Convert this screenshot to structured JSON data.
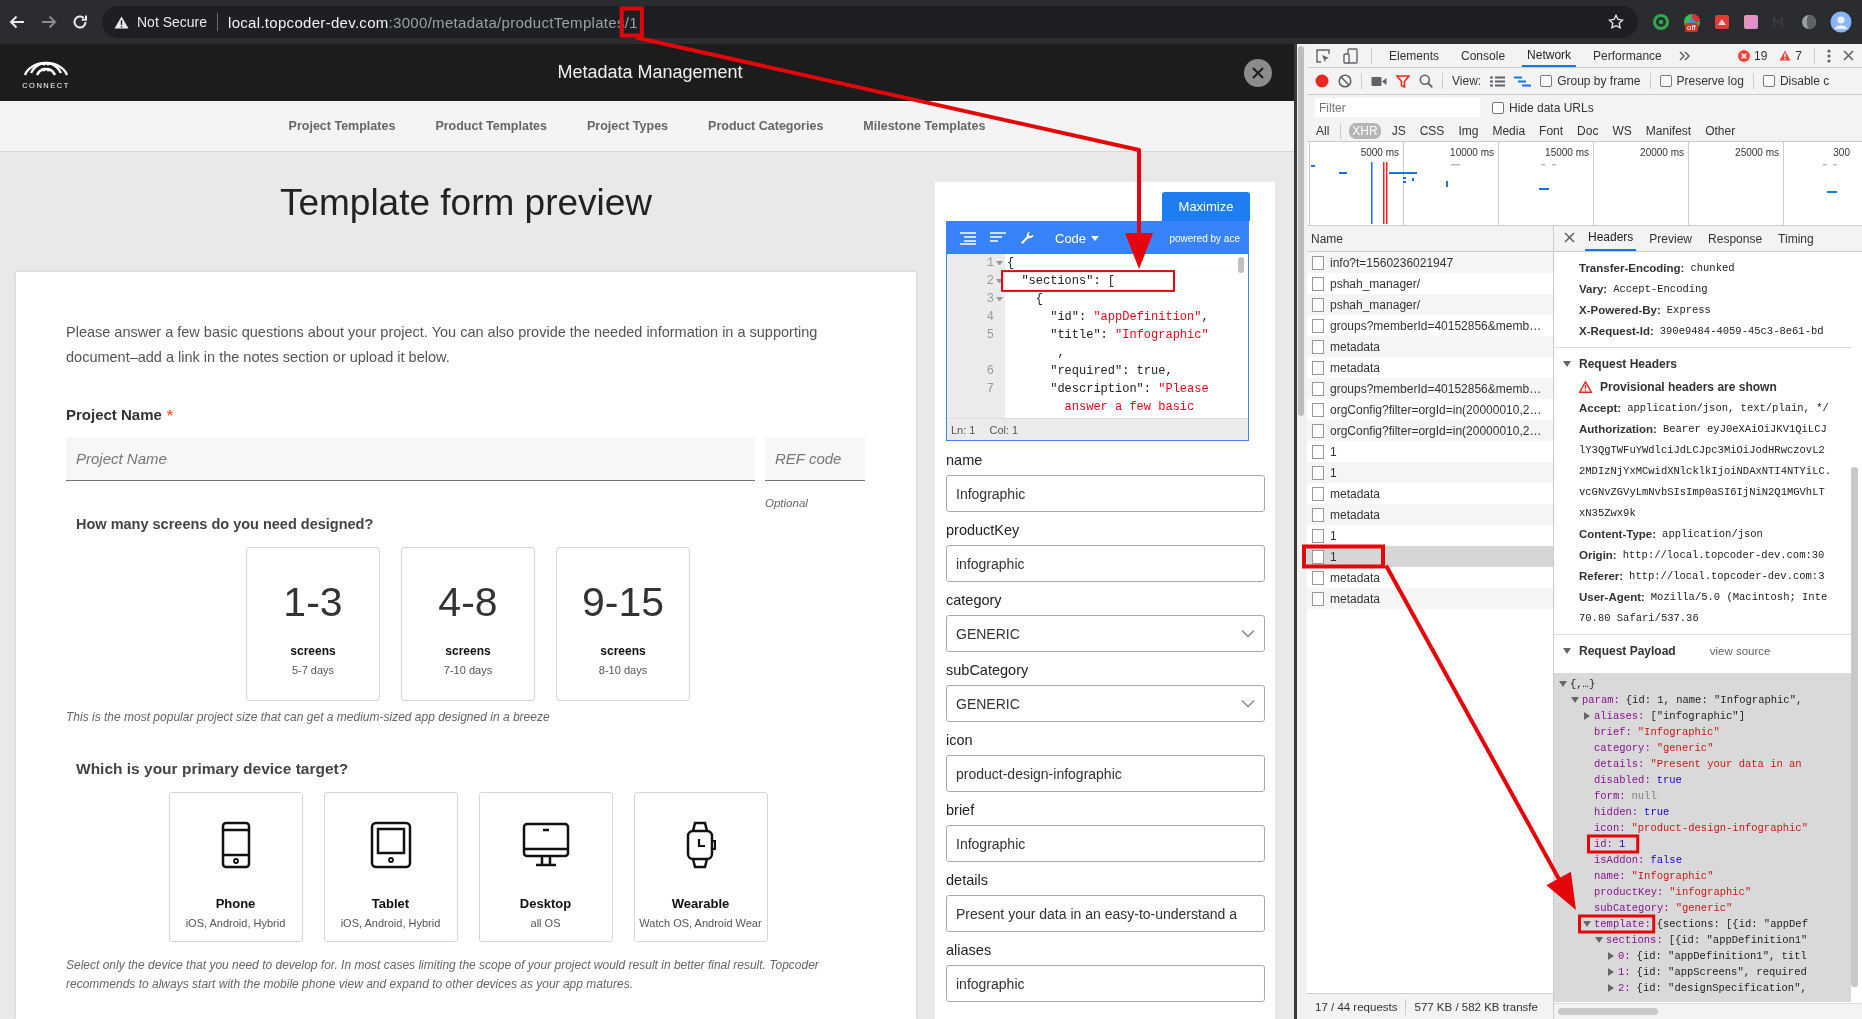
{
  "browser": {
    "security": "Not Secure",
    "host": "local.topcoder-dev.com",
    "path": ":3000/metadata/productTemplates/1",
    "extension_badge": "off"
  },
  "app": {
    "logo": "CONNECT",
    "title": "Metadata Management",
    "nav": [
      {
        "label": "Project Templates",
        "selected": false
      },
      {
        "label": "Product Templates",
        "selected": false
      },
      {
        "label": "Project Types",
        "selected": false
      },
      {
        "label": "Product Categories",
        "selected": false
      },
      {
        "label": "Milestone Templates",
        "selected": false
      }
    ]
  },
  "preview": {
    "title": "Template form preview",
    "intro": "Please answer a few basic questions about your project. You can also provide the needed information in a supporting document–add a link in the notes section or upload it below.",
    "project_name": {
      "label": "Project Name",
      "required_mark": "*",
      "placeholder": "Project Name"
    },
    "ref_code": {
      "placeholder": "REF code",
      "hint": "Optional"
    },
    "screens": {
      "question": "How many screens do you need designed?",
      "options": [
        {
          "count": "1-3",
          "unit": "screens",
          "duration": "5-7 days",
          "selected": false
        },
        {
          "count": "4-8",
          "unit": "screens",
          "duration": "7-10 days",
          "selected": false
        },
        {
          "count": "9-15",
          "unit": "screens",
          "duration": "8-10 days",
          "selected": false
        }
      ],
      "note": "This is the most popular project size that can get a medium-sized app designed in a breeze"
    },
    "devices": {
      "question": "Which is your primary device target?",
      "options": [
        {
          "kind": "phone",
          "name": "Phone",
          "platforms": "iOS, Android, Hybrid",
          "selected": false
        },
        {
          "kind": "tablet",
          "name": "Tablet",
          "platforms": "iOS, Android, Hybrid",
          "selected": false
        },
        {
          "kind": "desktop",
          "name": "Desktop",
          "platforms": "all OS",
          "selected": false
        },
        {
          "kind": "wearable",
          "name": "Wearable",
          "platforms": "Watch OS, Android Wear",
          "selected": false
        }
      ],
      "note": "Select only the device that you need to develop for. In most cases limiting the scope of your project would result in better final result. Topcoder recommends to always start with the mobile phone view and expand to other devices as your app matures."
    }
  },
  "editor": {
    "maximize": "Maximize",
    "mode": "Code",
    "powered_by": "powered by ace",
    "lines": [
      {
        "number": "1",
        "expanded": true,
        "tokens": [
          {
            "kind": "plain",
            "text": "{"
          }
        ]
      },
      {
        "number": "2",
        "expanded": true,
        "tokens": [
          {
            "kind": "plain",
            "text": "  \"sections\": ["
          }
        ]
      },
      {
        "number": "3",
        "expanded": true,
        "tokens": [
          {
            "kind": "plain",
            "text": "    {"
          }
        ]
      },
      {
        "number": "4",
        "tokens": [
          {
            "kind": "plain",
            "text": "      \"id\": "
          },
          {
            "kind": "string",
            "text": "\"appDefinition\""
          },
          {
            "kind": "plain",
            "text": ","
          }
        ]
      },
      {
        "number": "5",
        "tokens": [
          {
            "kind": "plain",
            "text": "      \"title\": "
          },
          {
            "kind": "string",
            "text": "\"Infographic\""
          }
        ]
      },
      {
        "tokens": [
          {
            "kind": "plain",
            "text": "       ,"
          }
        ]
      },
      {
        "number": "6",
        "tokens": [
          {
            "kind": "plain",
            "text": "      \"required\": true,"
          }
        ]
      },
      {
        "number": "7",
        "tokens": [
          {
            "kind": "plain",
            "text": "      \"description\": "
          },
          {
            "kind": "string",
            "text": "\"Please"
          }
        ]
      },
      {
        "tokens": [
          {
            "kind": "string",
            "text": "        answer a few basic"
          }
        ]
      }
    ],
    "status": {
      "line": "Ln: 1",
      "column": "Col: 1"
    }
  },
  "fields": [
    {
      "label": "name",
      "kind": "text",
      "value": "Infographic"
    },
    {
      "label": "productKey",
      "kind": "text",
      "value": "infographic"
    },
    {
      "label": "category",
      "kind": "select",
      "value": "GENERIC"
    },
    {
      "label": "subCategory",
      "kind": "select",
      "value": "GENERIC"
    },
    {
      "label": "icon",
      "kind": "text",
      "value": "product-design-infographic"
    },
    {
      "label": "brief",
      "kind": "text",
      "value": "Infographic"
    },
    {
      "label": "details",
      "kind": "text",
      "value": "Present your data in an easy-to-understand a"
    },
    {
      "label": "aliases",
      "kind": "text",
      "value": "infographic"
    }
  ],
  "devtools": {
    "tabs": [
      {
        "label": "Elements",
        "selected": false
      },
      {
        "label": "Console",
        "selected": false
      },
      {
        "label": "Network",
        "selected": true
      },
      {
        "label": "Performance",
        "selected": false
      }
    ],
    "errors": "19",
    "warnings": "7",
    "view_label": "View:",
    "options": [
      {
        "label": "Group by frame",
        "checked": false
      },
      {
        "label": "Preserve log",
        "checked": false
      },
      {
        "label": "Disable c",
        "checked": false
      }
    ],
    "filter": {
      "placeholder": "Filter"
    },
    "hide_data_urls": {
      "label": "Hide data URLs",
      "checked": false
    },
    "types": [
      {
        "label": "All",
        "selected": false
      },
      {
        "label": "XHR",
        "selected": true
      },
      {
        "label": "JS",
        "selected": false
      },
      {
        "label": "CSS",
        "selected": false
      },
      {
        "label": "Img",
        "selected": false
      },
      {
        "label": "Media",
        "selected": false
      },
      {
        "label": "Font",
        "selected": false
      },
      {
        "label": "Doc",
        "selected": false
      },
      {
        "label": "WS",
        "selected": false
      },
      {
        "label": "Manifest",
        "selected": false
      },
      {
        "label": "Other",
        "selected": false
      }
    ],
    "timeline_ticks": [
      "5000 ms",
      "10000 ms",
      "15000 ms",
      "20000 ms",
      "25000 ms",
      "300"
    ],
    "requests": {
      "column": "Name",
      "rows": [
        {
          "name": "info?t=1560236021947",
          "selected": false
        },
        {
          "name": "pshah_manager/",
          "selected": false
        },
        {
          "name": "pshah_manager/",
          "selected": false
        },
        {
          "name": "groups?memberId=40152856&memb…",
          "selected": false
        },
        {
          "name": "metadata",
          "selected": false
        },
        {
          "name": "metadata",
          "selected": false
        },
        {
          "name": "groups?memberId=40152856&memb…",
          "selected": false
        },
        {
          "name": "orgConfig?filter=orgId=in(20000010,2…",
          "selected": false
        },
        {
          "name": "orgConfig?filter=orgId=in(20000010,2…",
          "selected": false
        },
        {
          "name": "1",
          "selected": false
        },
        {
          "name": "1",
          "selected": false
        },
        {
          "name": "metadata",
          "selected": false
        },
        {
          "name": "metadata",
          "selected": false
        },
        {
          "name": "1",
          "selected": false
        },
        {
          "name": "1",
          "selected": true
        },
        {
          "name": "metadata",
          "selected": false
        },
        {
          "name": "metadata",
          "selected": false
        }
      ]
    },
    "summary": {
      "requests": "17 / 44 requests",
      "transferred": "577 KB / 582 KB transfe"
    },
    "details": {
      "tabs": [
        {
          "label": "Headers",
          "selected": true
        },
        {
          "label": "Preview",
          "selected": false
        },
        {
          "label": "Response",
          "selected": false
        },
        {
          "label": "Timing",
          "selected": false
        }
      ],
      "response_headers": [
        {
          "name": "Transfer-Encoding:",
          "value": "chunked"
        },
        {
          "name": "Vary:",
          "value": "Accept-Encoding"
        },
        {
          "name": "X-Powered-By:",
          "value": "Express"
        },
        {
          "name": "X-Request-Id:",
          "value": "390e9484-4059-45c3-8e61-bd"
        }
      ],
      "request_headers": {
        "title": "Request Headers",
        "expanded": true,
        "warning": "Provisional headers are shown",
        "items": [
          {
            "name": "Accept:",
            "value": "application/json, text/plain, */"
          },
          {
            "name": "Authorization:",
            "value": "Bearer eyJ0eXAiOiJKV1QiLCJ",
            "continued": [
              "lY3QgTWFuYWdlciJdLCJpc3MiOiJodHRwczovL2",
              "2MDIzNjYxMCwidXNlcklkIjoiNDAxNTI4NTYiLC.",
              "vcGNvZGVyLmNvbSIsImp0aSI6IjNiN2Q1MGVhLT",
              "xN35Zwx9k"
            ]
          },
          {
            "name": "Content-Type:",
            "value": "application/json"
          },
          {
            "name": "Origin:",
            "value": "http://local.topcoder-dev.com:30"
          },
          {
            "name": "Referer:",
            "value": "http://local.topcoder-dev.com:3"
          },
          {
            "name": "User-Agent:",
            "value": "Mozilla/5.0 (Macintosh; Inte",
            "continued": [
              "70.80 Safari/537.36"
            ]
          }
        ]
      },
      "payload": {
        "title": "Request Payload",
        "expanded": true,
        "view_source": "view source",
        "tree": [
          {
            "value": "{,…}",
            "kind": "object",
            "expanded": true,
            "children": [
              {
                "key": "param:",
                "value": "{id: 1, name: \"Infographic\",",
                "kind": "object",
                "expanded": true,
                "children": [
                  {
                    "key": "aliases:",
                    "value": "[\"infographic\"]",
                    "kind": "object",
                    "expanded": false
                  },
                  {
                    "key": "brief:",
                    "value": "\"Infographic\"",
                    "kind": "string"
                  },
                  {
                    "key": "category:",
                    "value": "\"generic\"",
                    "kind": "string"
                  },
                  {
                    "key": "details:",
                    "value": "\"Present your data in an",
                    "kind": "string"
                  },
                  {
                    "key": "disabled:",
                    "value": "true",
                    "kind": "literal"
                  },
                  {
                    "key": "form:",
                    "value": "null",
                    "kind": "null"
                  },
                  {
                    "key": "hidden:",
                    "value": "true",
                    "kind": "literal"
                  },
                  {
                    "key": "icon:",
                    "value": "\"product-design-infographic\"",
                    "kind": "string"
                  },
                  {
                    "key": "id:",
                    "value": "1",
                    "kind": "literal"
                  },
                  {
                    "key": "isAddon:",
                    "value": "false",
                    "kind": "literal"
                  },
                  {
                    "key": "name:",
                    "value": "\"Infographic\"",
                    "kind": "string"
                  },
                  {
                    "key": "productKey:",
                    "value": "\"infographic\"",
                    "kind": "string"
                  },
                  {
                    "key": "subCategory:",
                    "value": "\"generic\"",
                    "kind": "string"
                  },
                  {
                    "key": "template:",
                    "value": "{sections: [{id: \"appDef",
                    "kind": "object",
                    "expanded": true,
                    "children": [
                      {
                        "key": "sections:",
                        "value": "[{id: \"appDefinition1\"",
                        "kind": "object",
                        "expanded": true,
                        "children": [
                          {
                            "key": "0:",
                            "value": "{id: \"appDefinition1\", titl",
                            "kind": "object",
                            "expanded": false
                          },
                          {
                            "key": "1:",
                            "value": "{id: \"appScreens\", required",
                            "kind": "object",
                            "expanded": false
                          },
                          {
                            "key": "2:",
                            "value": "{id: \"designSpecification\",",
                            "kind": "object",
                            "expanded": false
                          }
                        ]
                      }
                    ]
                  }
                ]
              }
            ]
          }
        ]
      }
    }
  }
}
